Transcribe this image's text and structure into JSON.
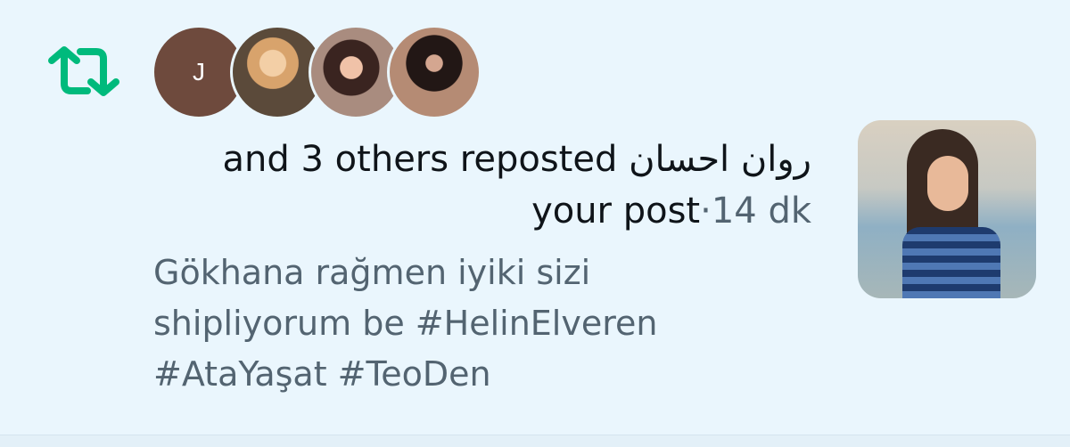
{
  "notification": {
    "icon": "repost-icon",
    "accent_color": "#00ba7c",
    "avatars": [
      {
        "initial": "J",
        "color": "#6e4a3d"
      },
      {
        "icon": "user-photo"
      },
      {
        "icon": "user-photo"
      },
      {
        "icon": "user-photo"
      }
    ],
    "user_name": "روان احسان",
    "action_text": "and 3 others reposted",
    "object_text": "your post",
    "separator": "·",
    "time": "14 dk",
    "post_lines": [
      "Gökhana rağmen iyiki sizi",
      "shipliyorum be #HelinElveren",
      "#AtaYaşat #TeoDen"
    ],
    "media": {
      "icon": "post-photo"
    }
  }
}
